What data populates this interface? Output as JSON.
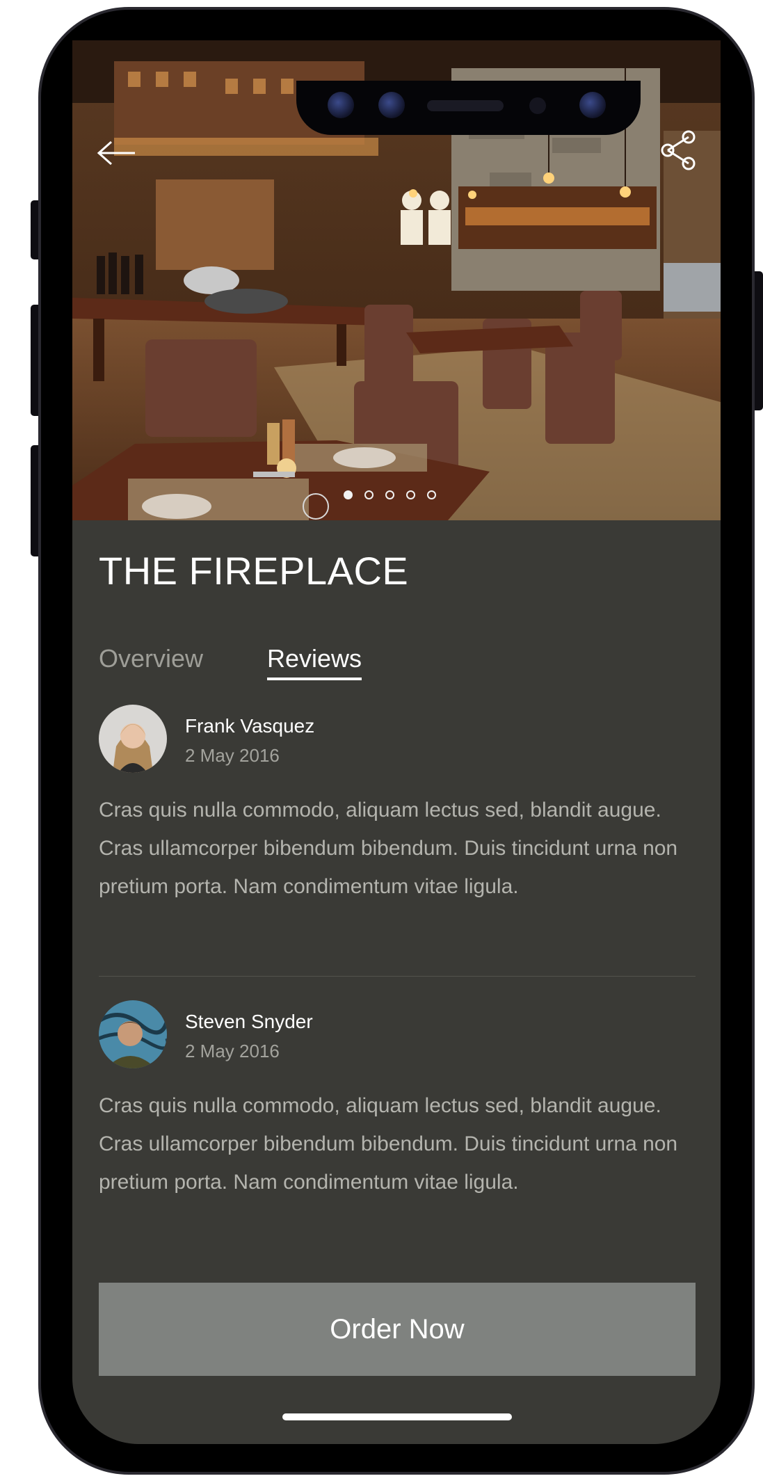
{
  "restaurant": {
    "name": "THE FIREPLACE",
    "hero_photo": "restaurant-interior-photo",
    "carousel": {
      "count": 5,
      "active_index": 0
    }
  },
  "tabs": [
    {
      "label": "Overview",
      "active": false
    },
    {
      "label": "Reviews",
      "active": true
    }
  ],
  "reviews": [
    {
      "author": "Frank Vasquez",
      "date": "2 May 2016",
      "text": "Cras quis nulla commodo, aliquam lectus sed, blandit augue. Cras ullamcorper bibendum bibendum. Duis tincidunt urna non pretium porta. Nam condimentum vitae ligula."
    },
    {
      "author": "Steven Snyder",
      "date": "2 May 2016",
      "text": "Cras quis nulla commodo, aliquam lectus sed, blandit augue. Cras ullamcorper bibendum bibendum. Duis tincidunt urna non pretium porta. Nam condimentum vitae ligula."
    }
  ],
  "order_button": {
    "label": "Order Now"
  },
  "icons": {
    "back": "arrow-left-icon",
    "share": "share-icon"
  },
  "colors": {
    "screen_bg": "#3a3a36",
    "button_bg": "#7f827f",
    "text_muted": "#b4b4ae"
  }
}
